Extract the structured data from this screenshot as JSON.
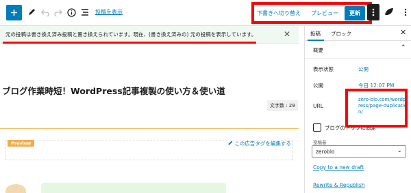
{
  "toolbar": {
    "add_icon": "plus-icon",
    "show_post_link": "投稿を表示",
    "switch_to_draft": "下書きへ切り替え",
    "preview": "プレビュー",
    "update": "更新"
  },
  "notice": {
    "text": "元の投稿は書き換え済み投稿と置き換えられています。現在、(書き換え済みの) 元の投稿を表示しています。"
  },
  "editor": {
    "title": "ブログ作業時短！WordPress記事複製の使い方＆使い道",
    "word_count": "文字数 : 29",
    "preview_badge": "Preview",
    "edit_ad_tag": "この広告タグを編集する"
  },
  "sidebar": {
    "tab_post": "投稿",
    "tab_block": "ブロック",
    "panel_title": "概要",
    "rows": [
      {
        "label": "表示状態",
        "value": "公開"
      },
      {
        "label": "公開",
        "value": "今日 12:07 PM"
      }
    ],
    "url_label": "URL",
    "url_value": "zero-blo.com/wordpress/page-duplication/",
    "sticky_label": "ブログのトップに固定",
    "author_label": "投稿者",
    "author_value": "zeroblo",
    "copy_link": "Copy to a new draft",
    "rewrite_link": "Rewrite & Republish"
  },
  "colors": {
    "accent": "#007cba",
    "highlight": "#ff0000",
    "notice_bg": "#eff9f1"
  }
}
